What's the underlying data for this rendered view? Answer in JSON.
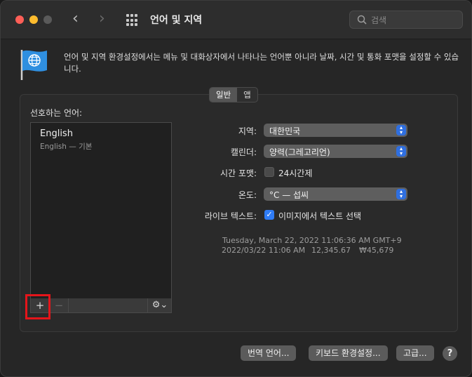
{
  "window": {
    "title": "언어 및 지역"
  },
  "search": {
    "placeholder": "검색"
  },
  "intro": "언어 및 지역 환경설정에서는 메뉴 및 대화상자에서 나타나는 언어뿐 아니라 날짜, 시간 및 통화 포맷을 설정할 수 있습니다.",
  "tabs": [
    {
      "label": "일반",
      "selected": true
    },
    {
      "label": "앱",
      "selected": false
    }
  ],
  "languages": {
    "label": "선호하는 언어:",
    "items": [
      {
        "name": "English",
        "sub": "English — 기본"
      }
    ],
    "toolbar": {
      "add": "+",
      "remove": "−",
      "gear": "⚙︎⌄"
    }
  },
  "settings": {
    "region": {
      "label": "지역:",
      "value": "대한민국"
    },
    "calendar": {
      "label": "캘린더:",
      "value": "양력(그레고리언)"
    },
    "time_format": {
      "label": "시간 포맷:",
      "option": "24시간제",
      "checked": false
    },
    "temperature": {
      "label": "온도:",
      "value": "°C — 섭씨"
    },
    "live_text": {
      "label": "라이브 텍스트:",
      "option": "이미지에서 텍스트 선택",
      "checked": true
    }
  },
  "sample": {
    "datetime_long": "Tuesday, March 22, 2022 11:06:36 AM GMT+9",
    "datetime_short": "2022/03/22 11:06 AM",
    "number": "12,345.67",
    "currency": "₩45,679"
  },
  "buttons": {
    "translation": "번역 언어...",
    "keyboard": "키보드 환경설정...",
    "advanced": "고급...",
    "help": "?"
  },
  "colors": {
    "accent": "#2f7cf6",
    "highlight": "#e5151a"
  }
}
